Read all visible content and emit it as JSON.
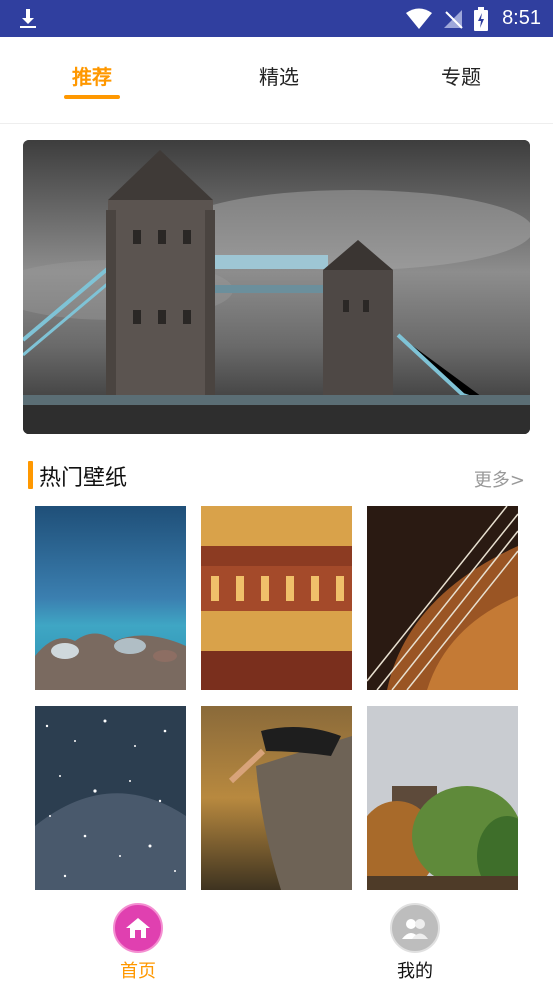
{
  "status_bar": {
    "time": "8:51",
    "icons": [
      "download-icon",
      "wifi-icon",
      "signal-off-icon",
      "battery-charging-icon"
    ]
  },
  "tabs": [
    {
      "label": "推荐",
      "active": true
    },
    {
      "label": "精选",
      "active": false
    },
    {
      "label": "专题",
      "active": false
    }
  ],
  "banner": {
    "subject": "tower-bridge-photo"
  },
  "section": {
    "title": "热门壁纸",
    "more": "更多>"
  },
  "wallpapers": [
    {
      "subject": "sea-rocks"
    },
    {
      "subject": "forbidden-city"
    },
    {
      "subject": "violin"
    },
    {
      "subject": "starry-sky"
    },
    {
      "subject": "cliff-sitter"
    },
    {
      "subject": "trees-building"
    }
  ],
  "bottom_nav": [
    {
      "label": "首页",
      "icon": "home-icon",
      "active": true
    },
    {
      "label": "我的",
      "icon": "profile-icon",
      "active": false
    }
  ],
  "colors": {
    "accent": "#ff9800",
    "status_bar": "#303f9f",
    "home_icon_bg": "#e040b0"
  }
}
